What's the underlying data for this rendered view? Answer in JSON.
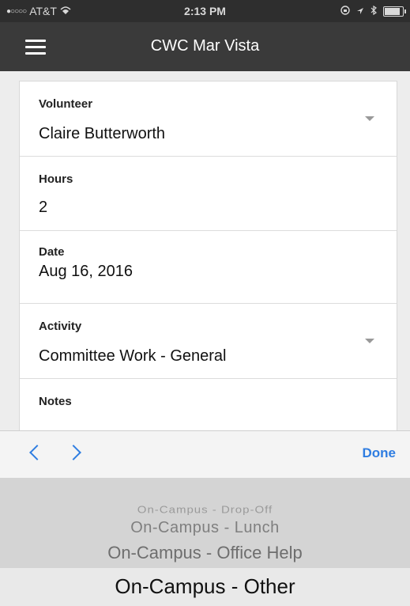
{
  "status_bar": {
    "carrier": "AT&T",
    "time": "2:13 PM"
  },
  "nav": {
    "title": "CWC Mar Vista"
  },
  "form": {
    "volunteer": {
      "label": "Volunteer",
      "value": "Claire Butterworth"
    },
    "hours": {
      "label": "Hours",
      "value": "2"
    },
    "date": {
      "label": "Date",
      "value": "Aug 16, 2016"
    },
    "activity": {
      "label": "Activity",
      "value": "Committee Work - General"
    },
    "notes": {
      "label": "Notes",
      "value": ""
    }
  },
  "toolbar": {
    "done_label": "Done"
  },
  "picker": {
    "options": [
      "On-Campus - Drop-Off",
      "On-Campus - Lunch",
      "On-Campus - Office Help",
      "On-Campus - Other"
    ],
    "selected": "On-Campus - Other"
  },
  "colors": {
    "accent": "#2f7de1",
    "nav_bg": "#3a3a3a",
    "status_bg": "#2e2e2e"
  }
}
